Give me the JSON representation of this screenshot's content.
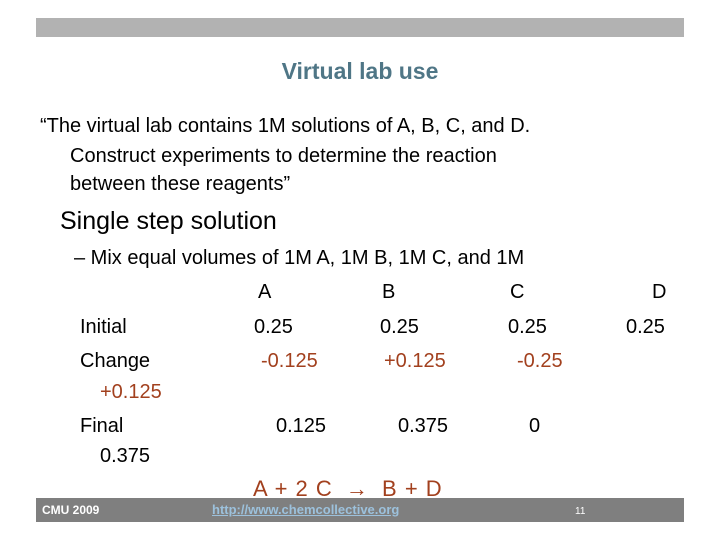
{
  "slide": {
    "title": "Virtual lab use",
    "quote_lines": [
      "“The virtual lab contains 1M solutions of A, B, C, and D.",
      "Construct experiments to determine the reaction",
      "between these reagents”"
    ],
    "heading": "Single step solution",
    "sub_bullet": "–  Mix equal volumes of 1M A, 1M B, 1M C, and 1M",
    "table": {
      "columns": [
        "A",
        "B",
        "C",
        "D"
      ],
      "rows": [
        {
          "label": "Initial",
          "values": [
            "0.25",
            "0.25",
            "0.25",
            "0.25"
          ]
        },
        {
          "label": "Change",
          "values": [
            "-0.125",
            "+0.125",
            "-0.25",
            "+0.125"
          ]
        },
        {
          "label": "Final",
          "values": [
            "0.125",
            "0.375",
            "0",
            "0.375"
          ]
        }
      ]
    },
    "equation": {
      "left": "A + 2 C",
      "arrow": "→",
      "right": "B + D"
    }
  },
  "footer": {
    "left": "CMU 2009",
    "link": "http://www.chemcollective.org",
    "page_number": "11"
  },
  "colors": {
    "title": "#4f7686",
    "change_values": "#a2401e",
    "header_bar": "#b2b2b2",
    "footer_bar": "#7f7f7f",
    "link": "#9cc1dc"
  }
}
